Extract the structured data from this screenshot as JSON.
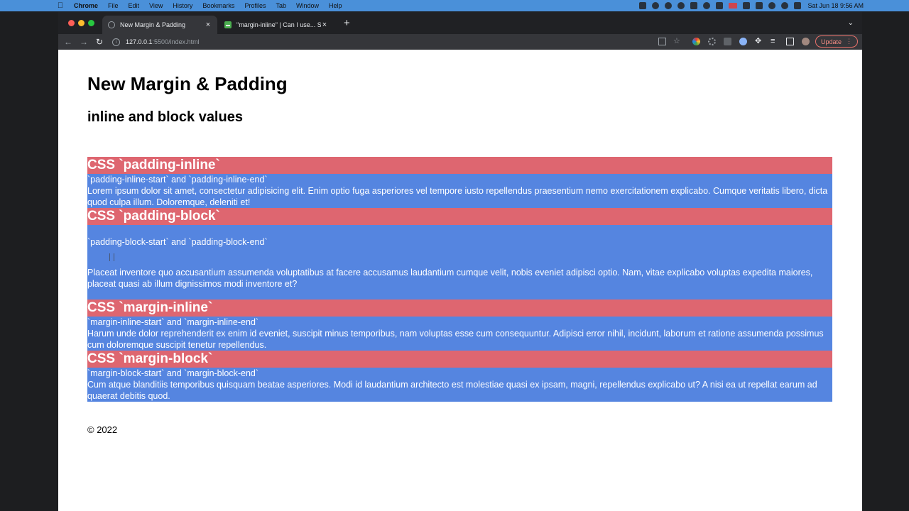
{
  "menubar": {
    "app": "Chrome",
    "items": [
      "File",
      "Edit",
      "View",
      "History",
      "Bookmarks",
      "Profiles",
      "Tab",
      "Window",
      "Help"
    ],
    "clock": "Sat Jun 18  9:56 AM"
  },
  "browser": {
    "tabs": [
      {
        "title": "New Margin & Padding"
      },
      {
        "title": "\"margin-inline\" | Can I use... Su"
      }
    ],
    "url_host": "127.0.0.1",
    "url_path": ":5500/index.html",
    "update_label": "Update"
  },
  "page": {
    "title": "New Margin & Padding",
    "subtitle": "inline and block values",
    "sections": [
      {
        "heading": "CSS `padding-inline`",
        "sub": "`padding-inline-start` and `padding-inline-end`",
        "body": "Lorem ipsum dolor sit amet, consectetur adipisicing elit. Enim optio fuga asperiores vel tempore iusto repellendus praesentium nemo exercitationem explicabo. Cumque veritatis libero, dicta quod culpa illum. Doloremque, deleniti et!"
      },
      {
        "heading": "CSS `padding-block`",
        "sub": "`padding-block-start` and `padding-block-end`",
        "body": "Placeat inventore quo accusantium assumenda voluptatibus at facere accusamus laudantium cumque velit, nobis eveniet adipisci optio. Nam, vitae explicabo voluptas expedita maiores, placeat quasi ab illum dignissimos modi inventore et?"
      },
      {
        "heading": "CSS `margin-inline`",
        "sub": "`margin-inline-start` and `margin-inline-end`",
        "body": "Harum unde dolor reprehenderit ex enim id eveniet, suscipit minus temporibus, nam voluptas esse cum consequuntur. Adipisci error nihil, incidunt, laborum et ratione assumenda possimus cum doloremque suscipit tenetur repellendus."
      },
      {
        "heading": "CSS `margin-block`",
        "sub": "`margin-block-start` and `margin-block-end`",
        "body": "Cum atque blanditiis temporibus quisquam beatae asperiores. Modi id laudantium architecto est molestiae quasi ex ipsam, magni, repellendus explicabo ut? A nisi ea ut repellat earum ad quaerat debitis quod."
      }
    ],
    "footer": "© 2022"
  },
  "colors": {
    "heading_bg": "#de6670",
    "card_bg": "#5585e0",
    "menubar_bg": "#4a90d9"
  }
}
